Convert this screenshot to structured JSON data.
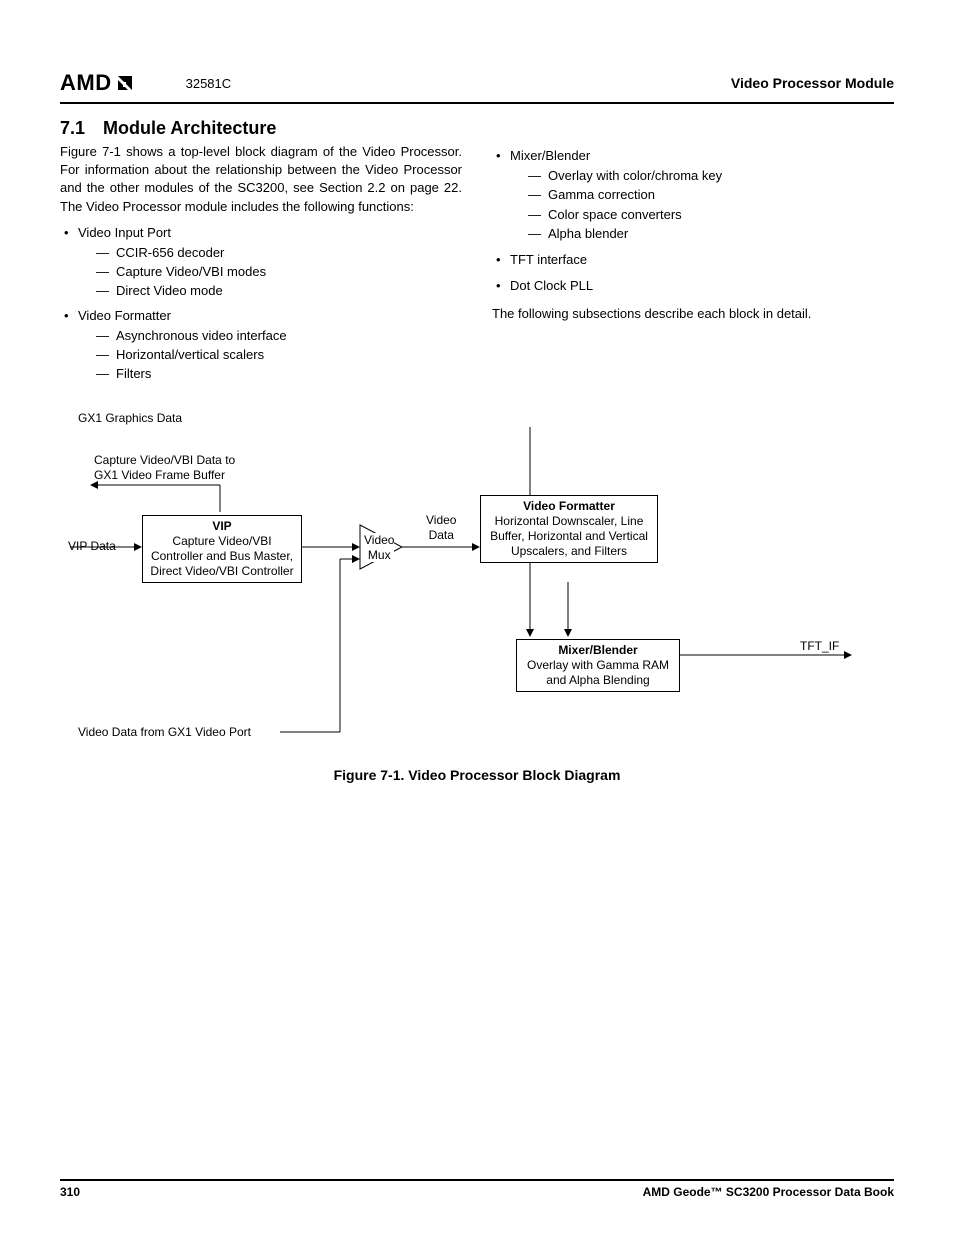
{
  "header": {
    "logo_text": "AMD",
    "doc_id": "32581C",
    "module": "Video Processor Module"
  },
  "section": {
    "number": "7.1",
    "title": "Module Architecture",
    "intro": "Figure 7-1 shows a top-level block diagram of the Video Processor. For information about the relationship between the Video Processor and the other modules of the SC3200, see Section 2.2 on page 22. The Video Processor module includes the following functions:"
  },
  "left_list": [
    {
      "label": "Video Input Port",
      "subs": [
        "CCIR-656 decoder",
        "Capture Video/VBI modes",
        "Direct Video mode"
      ]
    },
    {
      "label": "Video Formatter",
      "subs": [
        "Asynchronous video interface",
        "Horizontal/vertical scalers",
        "Filters"
      ]
    }
  ],
  "right_list": [
    {
      "label": "Mixer/Blender",
      "subs": [
        "Overlay with color/chroma key",
        "Gamma correction",
        "Color space converters",
        "Alpha blender"
      ]
    },
    {
      "label": "TFT interface",
      "subs": []
    },
    {
      "label": "Dot Clock PLL",
      "subs": []
    }
  ],
  "right_tail": "The following subsections describe each block in detail.",
  "diagram": {
    "gx1_graphics": "GX1 Graphics Data",
    "capture_to": "Capture Video/VBI Data to\nGX1 Video Frame Buffer",
    "vip_data": "VIP Data",
    "vip_title": "VIP",
    "vip_body": "Capture Video/VBI Controller and Bus Master, Direct Video/VBI Controller",
    "video_mux": "Video\nMux",
    "video_data": "Video\nData",
    "formatter_title": "Video Formatter",
    "formatter_body": "Horizontal Downscaler, Line Buffer, Horizontal and Vertical Upscalers, and Filters",
    "mixer_title": "Mixer/Blender",
    "mixer_body": "Overlay with Gamma RAM and Alpha Blending",
    "tft_if": "TFT_IF",
    "video_from_gx1": "Video Data from GX1 Video Port"
  },
  "figure_caption": "Figure 7-1.  Video Processor Block Diagram",
  "footer": {
    "page": "310",
    "book": "AMD Geode™ SC3200 Processor Data Book"
  }
}
